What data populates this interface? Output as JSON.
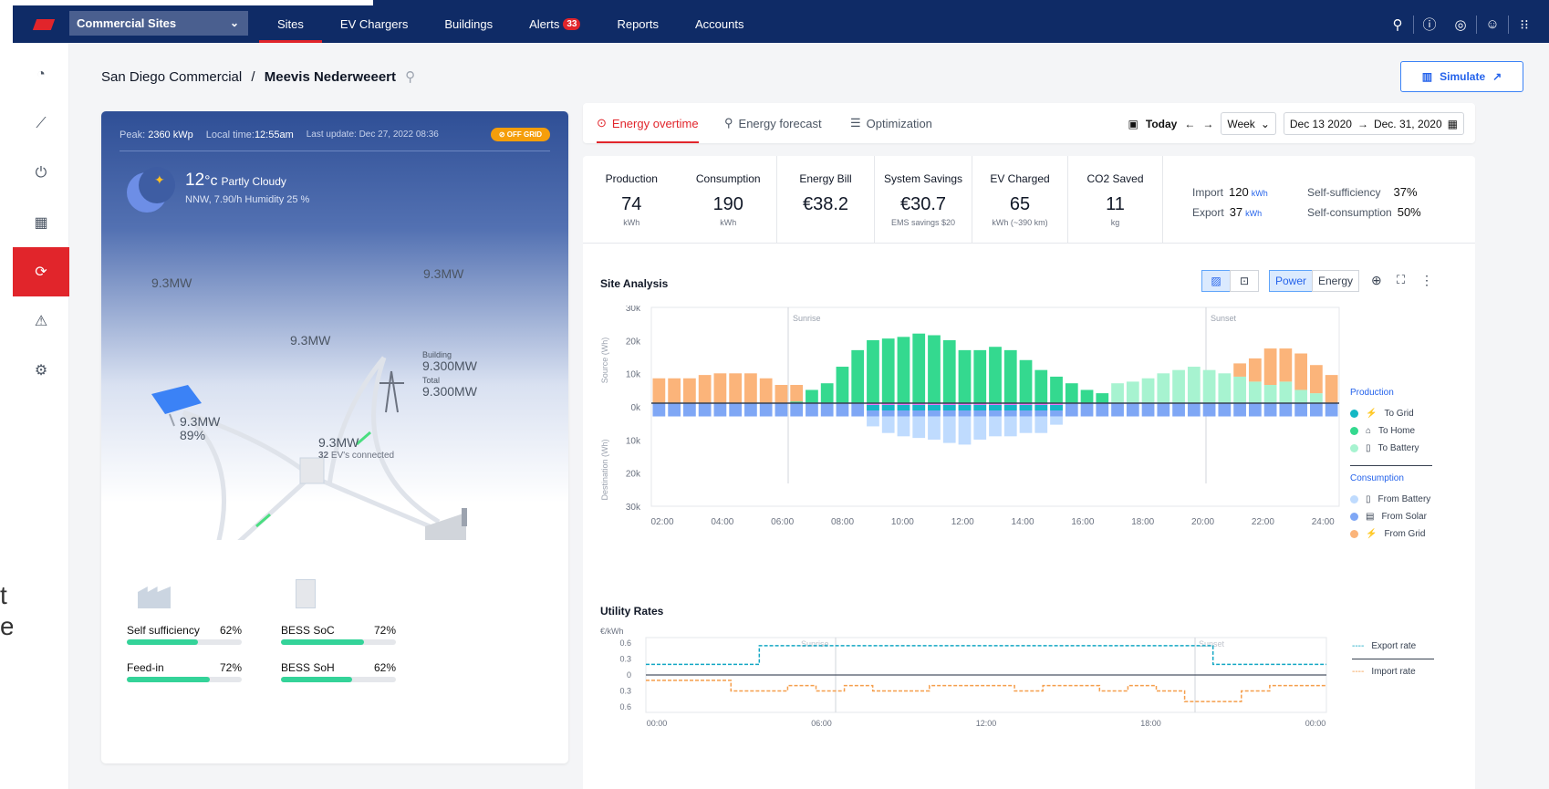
{
  "clipped_text": {
    "line1": "t",
    "line2": "e"
  },
  "topbar": {
    "site_selector": "Commercial Sites",
    "nav": [
      {
        "label": "Sites",
        "active": true
      },
      {
        "label": "EV Chargers"
      },
      {
        "label": "Buildings"
      },
      {
        "label": "Alerts",
        "badge": "33"
      },
      {
        "label": "Reports"
      },
      {
        "label": "Accounts"
      }
    ],
    "icons": [
      "search-icon",
      "help-icon",
      "support-icon",
      "user-icon",
      "apps-icon"
    ]
  },
  "sidebar": {
    "items": [
      "dashboard-icon",
      "analytics-icon",
      "charger-icon",
      "building-icon",
      "energy-flow-icon",
      "alert-icon",
      "settings-icon"
    ],
    "active_index": 4
  },
  "breadcrumb": {
    "parent": "San Diego Commercial",
    "separator": "/",
    "current": "Meevis Nederweeert"
  },
  "simulate_label": "Simulate",
  "site_panel": {
    "peak_label": "Peak:",
    "peak_value": "2360 kWp",
    "local_label": "Local time:",
    "local_value": "12:55am",
    "last_update": "Last update: Dec 27, 2022 08:36",
    "status_badge": "OFF GRID",
    "weather": {
      "temp": "12",
      "deg": "°c",
      "condition": "Partly Cloudy",
      "details": "NNW, 7.90/h  Humidity 25 %"
    },
    "solar_mw": "9.3MW",
    "grid_mw": "9.3MW",
    "hub_mw": "9.3MW",
    "building": {
      "label1": "Building",
      "value1": "9.300MW",
      "label2": "Total",
      "value2": "9.300MW"
    },
    "battery": {
      "mw": "9.3MW",
      "pct": "89%"
    },
    "ev": {
      "mw": "9.3MW",
      "count": "32",
      "count_label": "EV's connected"
    },
    "stats": [
      {
        "label": "Self sufficiency",
        "value": "62%",
        "fraction": 0.62
      },
      {
        "label": "BESS SoC",
        "value": "72%",
        "fraction": 0.72
      },
      {
        "label": "Feed-in",
        "value": "72%",
        "fraction": 0.72
      },
      {
        "label": "BESS SoH",
        "value": "62%",
        "fraction": 0.62
      }
    ]
  },
  "tabs": [
    {
      "label": "Energy overtime",
      "active": true
    },
    {
      "label": "Energy forecast"
    },
    {
      "label": "Optimization"
    }
  ],
  "date_controls": {
    "today": "Today",
    "period": "Week",
    "from": "Dec 13 2020",
    "arrow": "→",
    "to": "Dec. 31, 2020"
  },
  "metrics": [
    {
      "label": "Production",
      "value": "74",
      "unit": "kWh"
    },
    {
      "label": "Consumption",
      "value": "190",
      "unit": "kWh"
    },
    {
      "label": "Energy Bill",
      "value": "€38.2",
      "unit": ""
    },
    {
      "label": "System Savings",
      "value": "€30.7",
      "unit": "EMS savings $20"
    },
    {
      "label": "EV Charged",
      "value": "65",
      "unit": "kWh (~390 km)"
    },
    {
      "label": "CO2 Saved",
      "value": "11",
      "unit": "kg"
    }
  ],
  "import_export": {
    "import_label": "Import",
    "import_value": "120",
    "import_unit": "kWh",
    "export_label": "Export",
    "export_value": "37",
    "export_unit": "kWh",
    "self_suff_label": "Self-sufficiency",
    "self_suff_value": "37%",
    "self_cons_label": "Self-consumption",
    "self_cons_value": "50%"
  },
  "site_analysis": {
    "title": "Site Analysis",
    "toggle_power": "Power",
    "toggle_energy": "Energy",
    "legend_production": "Production",
    "legend_consumption": "Consumption",
    "colors": {
      "to_grid": "#14b8c4",
      "to_home": "#34d98f",
      "to_battery": "#a7f3d0",
      "from_battery": "#bfdbfe",
      "from_solar": "#7fa7f5",
      "from_grid": "#fbb47a",
      "mixed": "#e879f9"
    }
  },
  "chart_data": [
    {
      "type": "bar",
      "title": "Site Analysis",
      "ylabel_top": "Source (Wh)",
      "ylabel_bottom": "Destination (Wh)",
      "y_ticks": [
        "30k",
        "20k",
        "10k",
        "0k",
        "10k",
        "20k",
        "30k"
      ],
      "x_ticks": [
        "02:00",
        "04:00",
        "06:00",
        "08:00",
        "10:00",
        "12:00",
        "14:00",
        "16:00",
        "18:00",
        "20:00",
        "22:00",
        "24:00"
      ],
      "annotations": [
        "Sunrise",
        "Sunset"
      ],
      "ylim": [
        -30000,
        30000
      ],
      "series": [
        {
          "name": "To Grid",
          "values": [
            0,
            0,
            0,
            0,
            0,
            0,
            0,
            0,
            0,
            0,
            0,
            0,
            0,
            0,
            0,
            0,
            0,
            0,
            0,
            0,
            0,
            0,
            0,
            0,
            0,
            0,
            0,
            0,
            0,
            0,
            0,
            0,
            0,
            0,
            0,
            0,
            0,
            0,
            0,
            0,
            0,
            0,
            0,
            0,
            0
          ]
        },
        {
          "name": "To Home",
          "values": [
            0,
            0,
            0,
            0,
            0,
            0,
            0,
            0,
            0,
            500,
            4000,
            6000,
            11000,
            16000,
            19000,
            19500,
            20000,
            21000,
            20500,
            19000,
            16000,
            16000,
            17000,
            16000,
            13000,
            10000,
            8000,
            6000,
            4000,
            3000,
            0,
            0,
            0,
            0,
            0,
            0,
            0,
            0,
            0,
            0,
            0,
            0,
            0,
            0,
            0
          ]
        },
        {
          "name": "To Battery",
          "values": [
            0,
            0,
            0,
            0,
            0,
            0,
            0,
            0,
            0,
            0,
            0,
            0,
            0,
            0,
            0,
            0,
            0,
            0,
            0,
            0,
            0,
            0,
            0,
            0,
            0,
            0,
            0,
            0,
            0,
            0,
            6000,
            6500,
            7500,
            9000,
            10000,
            11000,
            10000,
            9000,
            8000,
            6500,
            5500,
            6500,
            4000,
            3000,
            0
          ]
        },
        {
          "name": "From Grid",
          "values": [
            7500,
            7500,
            7500,
            8500,
            9000,
            9000,
            9000,
            7500,
            5500,
            5000,
            0,
            0,
            0,
            0,
            0,
            0,
            0,
            0,
            0,
            0,
            0,
            0,
            0,
            0,
            0,
            0,
            0,
            0,
            0,
            0,
            0,
            0,
            0,
            0,
            0,
            0,
            0,
            0,
            4000,
            7000,
            11000,
            10000,
            11000,
            8500,
            8500
          ]
        },
        {
          "name": "From Solar",
          "values": [
            -4000,
            -4000,
            -4000,
            -4000,
            -4000,
            -4000,
            -4000,
            -4000,
            -4000,
            -4000,
            -4000,
            -4000,
            -4000,
            -4000,
            -4000,
            -4000,
            -4000,
            -4000,
            -4000,
            -4000,
            -4000,
            -4000,
            -4000,
            -4000,
            -4000,
            -4000,
            -4000,
            -4000,
            -4000,
            -4000,
            -4000,
            -4000,
            -4000,
            -4000,
            -4000,
            -4000,
            -4000,
            -4000,
            -4000,
            -4000,
            -4000,
            -4000,
            -4000,
            -4000,
            -4000
          ]
        },
        {
          "name": "From Battery",
          "values": [
            0,
            0,
            0,
            0,
            0,
            0,
            0,
            0,
            0,
            0,
            0,
            0,
            0,
            0,
            -7000,
            -9000,
            -10000,
            -10500,
            -11000,
            -12000,
            -12500,
            -11000,
            -10000,
            -10000,
            -9000,
            -9000,
            -6500,
            0,
            0,
            0,
            0,
            0,
            0,
            0,
            0,
            0,
            0,
            0,
            0,
            0,
            0,
            0,
            0,
            0,
            0
          ]
        }
      ]
    },
    {
      "type": "line",
      "title": "Utility Rates",
      "ylabel": "€/kWh",
      "y_ticks": [
        "0.6",
        "0.3",
        "0",
        "0.3",
        "0.6"
      ],
      "x_ticks": [
        "00:00",
        "06:00",
        "12:00",
        "18:00",
        "00:00"
      ],
      "annotations": [
        "Sunrise",
        "Sunset"
      ],
      "series": [
        {
          "name": "Export rate",
          "values": [
            0.2,
            0.2,
            0.2,
            0.2,
            0.55,
            0.55,
            0.55,
            0.55,
            0.55,
            0.55,
            0.55,
            0.55,
            0.55,
            0.55,
            0.55,
            0.55,
            0.55,
            0.55,
            0.55,
            0.55,
            0.2,
            0.2,
            0.2,
            0.2
          ]
        },
        {
          "name": "Import rate",
          "values": [
            -0.1,
            -0.1,
            -0.1,
            -0.3,
            -0.3,
            -0.2,
            -0.3,
            -0.2,
            -0.3,
            -0.3,
            -0.2,
            -0.2,
            -0.2,
            -0.3,
            -0.2,
            -0.2,
            -0.3,
            -0.2,
            -0.3,
            -0.5,
            -0.5,
            -0.3,
            -0.2,
            -0.2
          ]
        }
      ]
    }
  ],
  "utility_rates": {
    "title": "Utility Rates",
    "legend_export": "Export rate",
    "legend_import": "Import rate",
    "export_color": "#14a7c4",
    "import_color": "#f59e4b"
  }
}
